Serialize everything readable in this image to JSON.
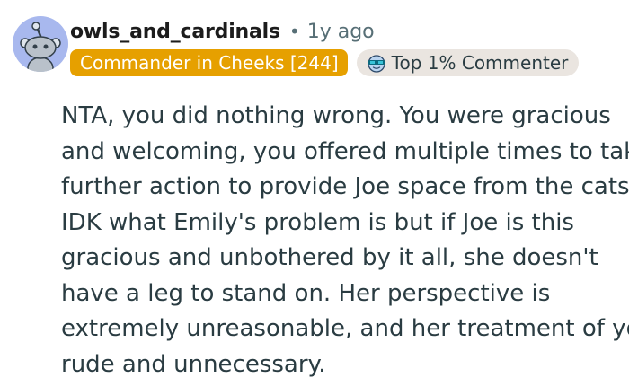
{
  "comment": {
    "author": {
      "username": "owls_and_cardinals",
      "avatar_icon": "snoo-avatar-icon",
      "avatar_bg": "#a8b8ee"
    },
    "separator": "•",
    "age": "1y ago",
    "flair": {
      "text": "Commander in Cheeks [244]",
      "bg": "#e6a000"
    },
    "top_badge": {
      "icon": "sunglasses-face-icon",
      "text": "Top 1% Commenter"
    },
    "body_lines": [
      "NTA, you did nothing wrong. You were gracious",
      "and welcoming, you offered multiple times to take",
      "further action to provide Joe space from the cats.",
      "IDK what Emily's problem is but if Joe is this",
      "gracious and unbothered by it all, she doesn't",
      "have a leg to stand on. Her perspective is",
      "extremely unreasonable, and her treatment of you",
      "rude and unnecessary."
    ]
  }
}
